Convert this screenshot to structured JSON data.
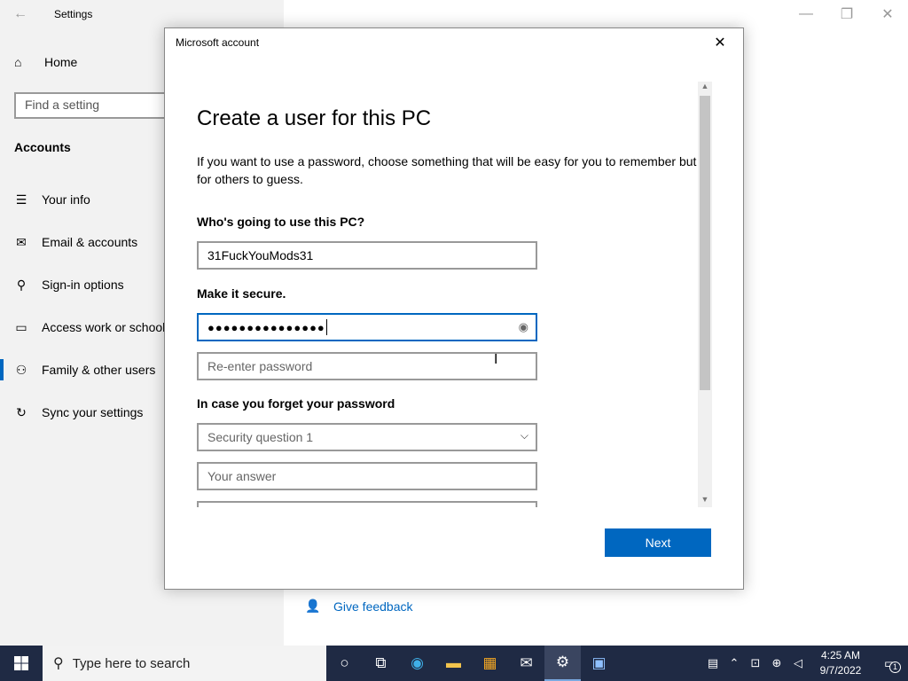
{
  "settings": {
    "window_title": "Settings",
    "home_label": "Home",
    "search_placeholder": "Find a setting",
    "section_heading": "Accounts",
    "nav_items": [
      {
        "label": "Your info",
        "icon": "person-card-icon"
      },
      {
        "label": "Email & accounts",
        "icon": "mail-icon"
      },
      {
        "label": "Sign-in options",
        "icon": "key-icon"
      },
      {
        "label": "Access work or school",
        "icon": "briefcase-icon"
      },
      {
        "label": "Family & other users",
        "icon": "people-icon",
        "active": true
      },
      {
        "label": "Sync your settings",
        "icon": "sync-icon"
      }
    ],
    "feedback_label": "Give feedback"
  },
  "dialog": {
    "title": "Microsoft account",
    "heading": "Create a user for this PC",
    "intro": "If you want to use a password, choose something that will be easy for you to remember but hard for others to guess.",
    "who_label": "Who's going to use this PC?",
    "username_value": "31FuckYouMods31",
    "secure_label": "Make it secure.",
    "password_value": "●●●●●●●●●●●●●●●",
    "reenter_placeholder": "Re-enter password",
    "forget_label": "In case you forget your password",
    "security_question_value": "Security question 1",
    "answer_placeholder": "Your answer",
    "next_label": "Next"
  },
  "taskbar": {
    "search_placeholder": "Type here to search",
    "time": "4:25 AM",
    "date": "9/7/2022",
    "notification_count": "1"
  },
  "colors": {
    "accent": "#0067c0",
    "taskbar": "#1f2a44"
  }
}
